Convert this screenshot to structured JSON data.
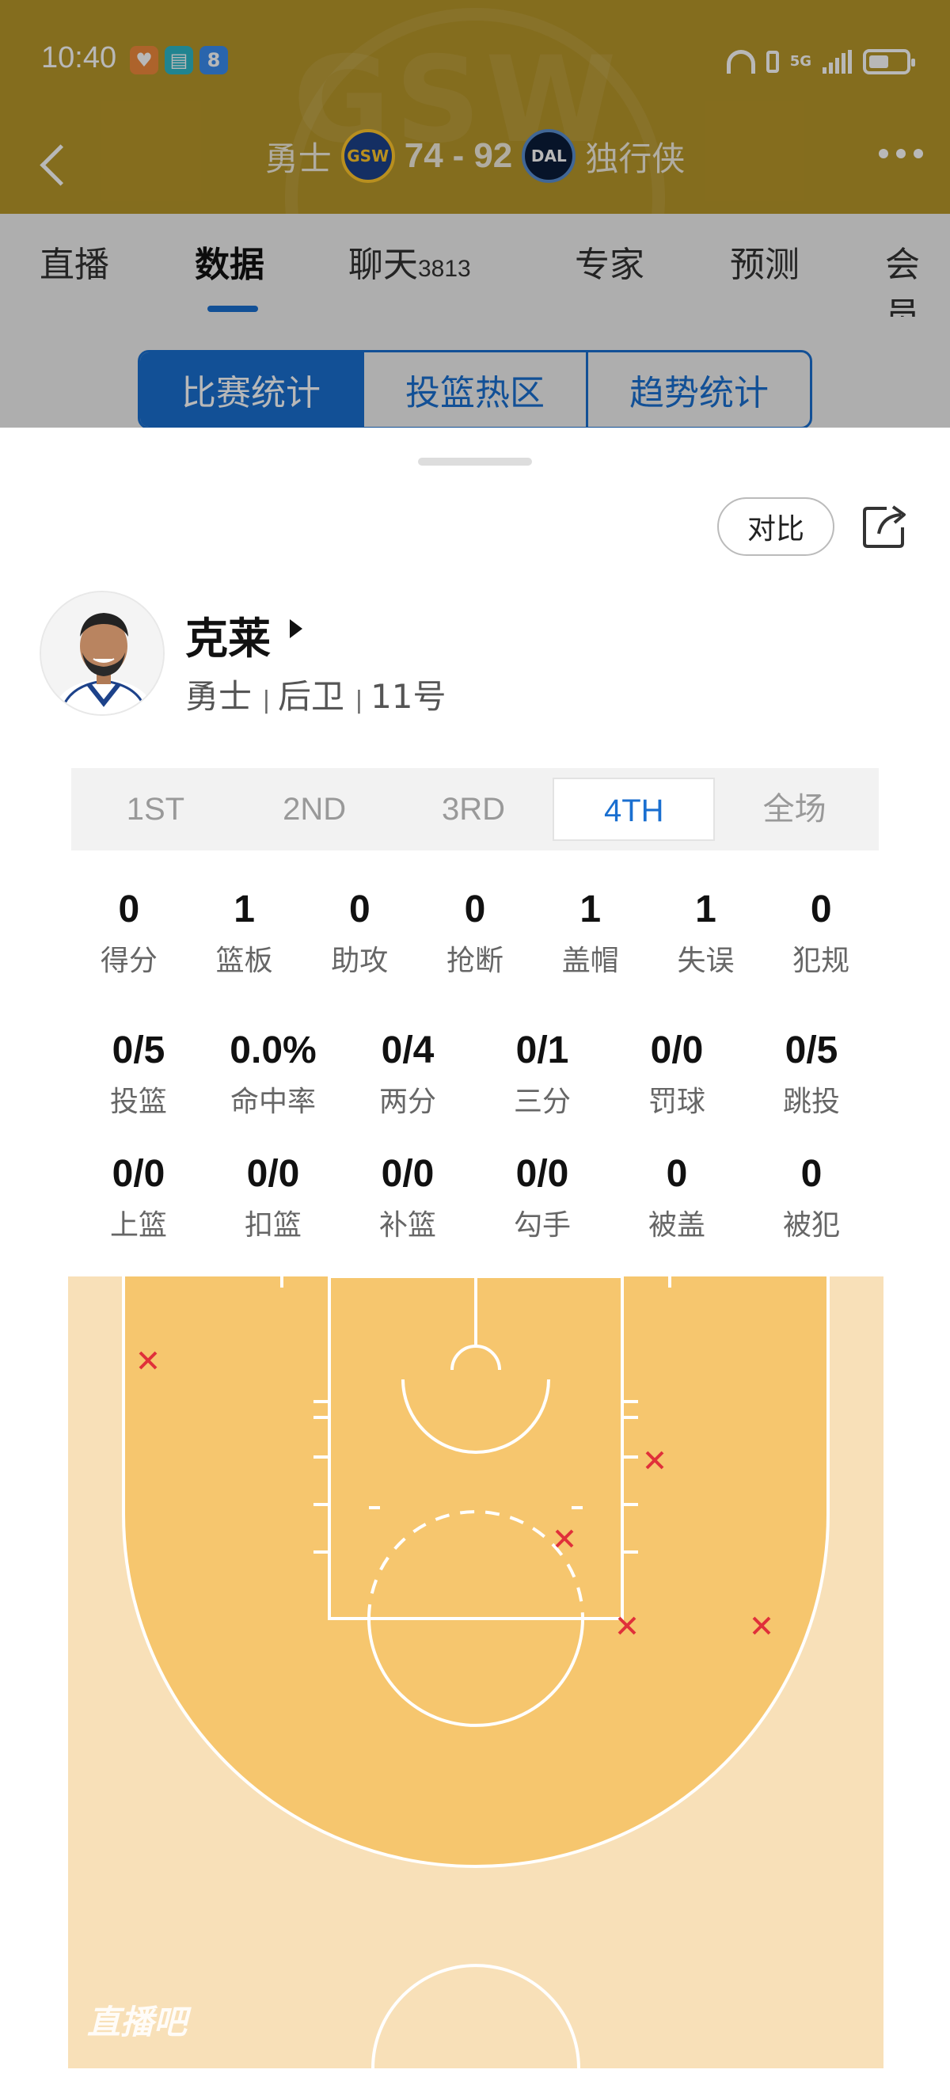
{
  "status_bar": {
    "time": "10:40",
    "network": "5G"
  },
  "header": {
    "home_team": "勇士",
    "home_abbr": "GSW",
    "home_score": "74",
    "away_score": "92",
    "score_sep": "-",
    "away_abbr": "DAL",
    "away_team": "独行侠",
    "bg_color": "#b8972a"
  },
  "tabs": [
    {
      "label": "直播"
    },
    {
      "label": "数据"
    },
    {
      "label": "聊天",
      "count": "3813"
    },
    {
      "label": "专家"
    },
    {
      "label": "预测"
    },
    {
      "label": "会员"
    }
  ],
  "stat_tabs": [
    "比赛统计",
    "投篮热区",
    "趋势统计"
  ],
  "sheet": {
    "compare_label": "对比",
    "player": {
      "name": "克莱",
      "team": "勇士",
      "position": "后卫",
      "number": "11号"
    },
    "quarters": [
      "1ST",
      "2ND",
      "3RD",
      "4TH",
      "全场"
    ],
    "active_quarter": "4TH",
    "stats_row1": [
      {
        "value": "0",
        "label": "得分"
      },
      {
        "value": "1",
        "label": "篮板"
      },
      {
        "value": "0",
        "label": "助攻"
      },
      {
        "value": "0",
        "label": "抢断"
      },
      {
        "value": "1",
        "label": "盖帽"
      },
      {
        "value": "1",
        "label": "失误"
      },
      {
        "value": "0",
        "label": "犯规"
      }
    ],
    "stats_row2": [
      {
        "value": "0/5",
        "label": "投篮"
      },
      {
        "value": "0.0%",
        "label": "命中率"
      },
      {
        "value": "0/4",
        "label": "两分"
      },
      {
        "value": "0/1",
        "label": "三分"
      },
      {
        "value": "0/0",
        "label": "罚球"
      },
      {
        "value": "0/5",
        "label": "跳投"
      }
    ],
    "stats_row3": [
      {
        "value": "0/0",
        "label": "上篮"
      },
      {
        "value": "0/0",
        "label": "扣篮"
      },
      {
        "value": "0/0",
        "label": "补篮"
      },
      {
        "value": "0/0",
        "label": "勾手"
      },
      {
        "value": "0",
        "label": "被盖"
      },
      {
        "value": "0",
        "label": "被犯"
      }
    ],
    "shot_chart": {
      "result": "miss",
      "miss_count": 5,
      "watermark": "直播吧"
    }
  },
  "colors": {
    "accent": "#1a6fd0",
    "court_inner": "#f6c66e",
    "court_outer": "#f8e0b8",
    "miss_mark": "#e0303a"
  }
}
